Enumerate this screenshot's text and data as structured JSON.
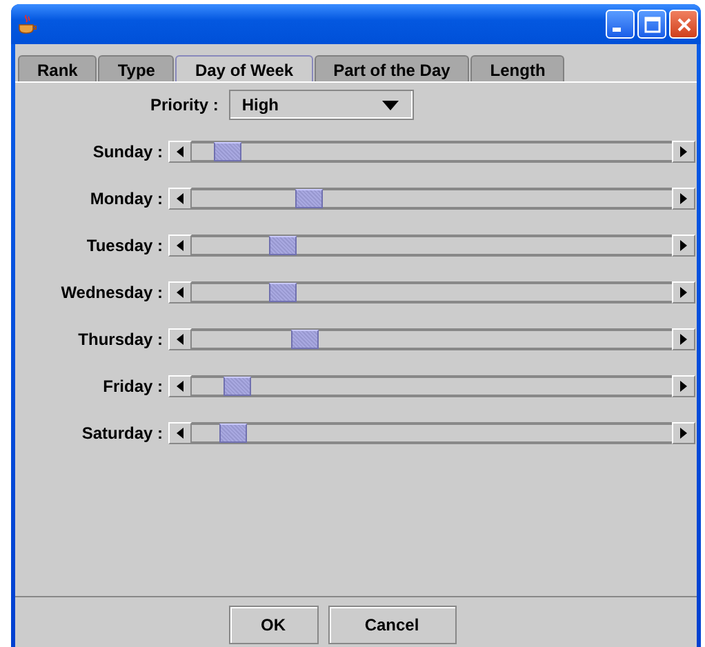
{
  "tabs": [
    {
      "label": "Rank",
      "selected": false
    },
    {
      "label": "Type",
      "selected": false
    },
    {
      "label": "Day of Week",
      "selected": true
    },
    {
      "label": "Part of the Day",
      "selected": false
    },
    {
      "label": "Length",
      "selected": false
    }
  ],
  "priority": {
    "label": "Priority :",
    "value": "High"
  },
  "days": [
    {
      "label": "Sunday :",
      "level": 0.05
    },
    {
      "label": "Monday :",
      "level": 0.23
    },
    {
      "label": "Tuesday :",
      "level": 0.17
    },
    {
      "label": "Wednesday :",
      "level": 0.17
    },
    {
      "label": "Thursday :",
      "level": 0.22
    },
    {
      "label": "Friday :",
      "level": 0.07
    },
    {
      "label": "Saturday :",
      "level": 0.06
    }
  ],
  "buttons": [
    "OK",
    "Cancel"
  ]
}
